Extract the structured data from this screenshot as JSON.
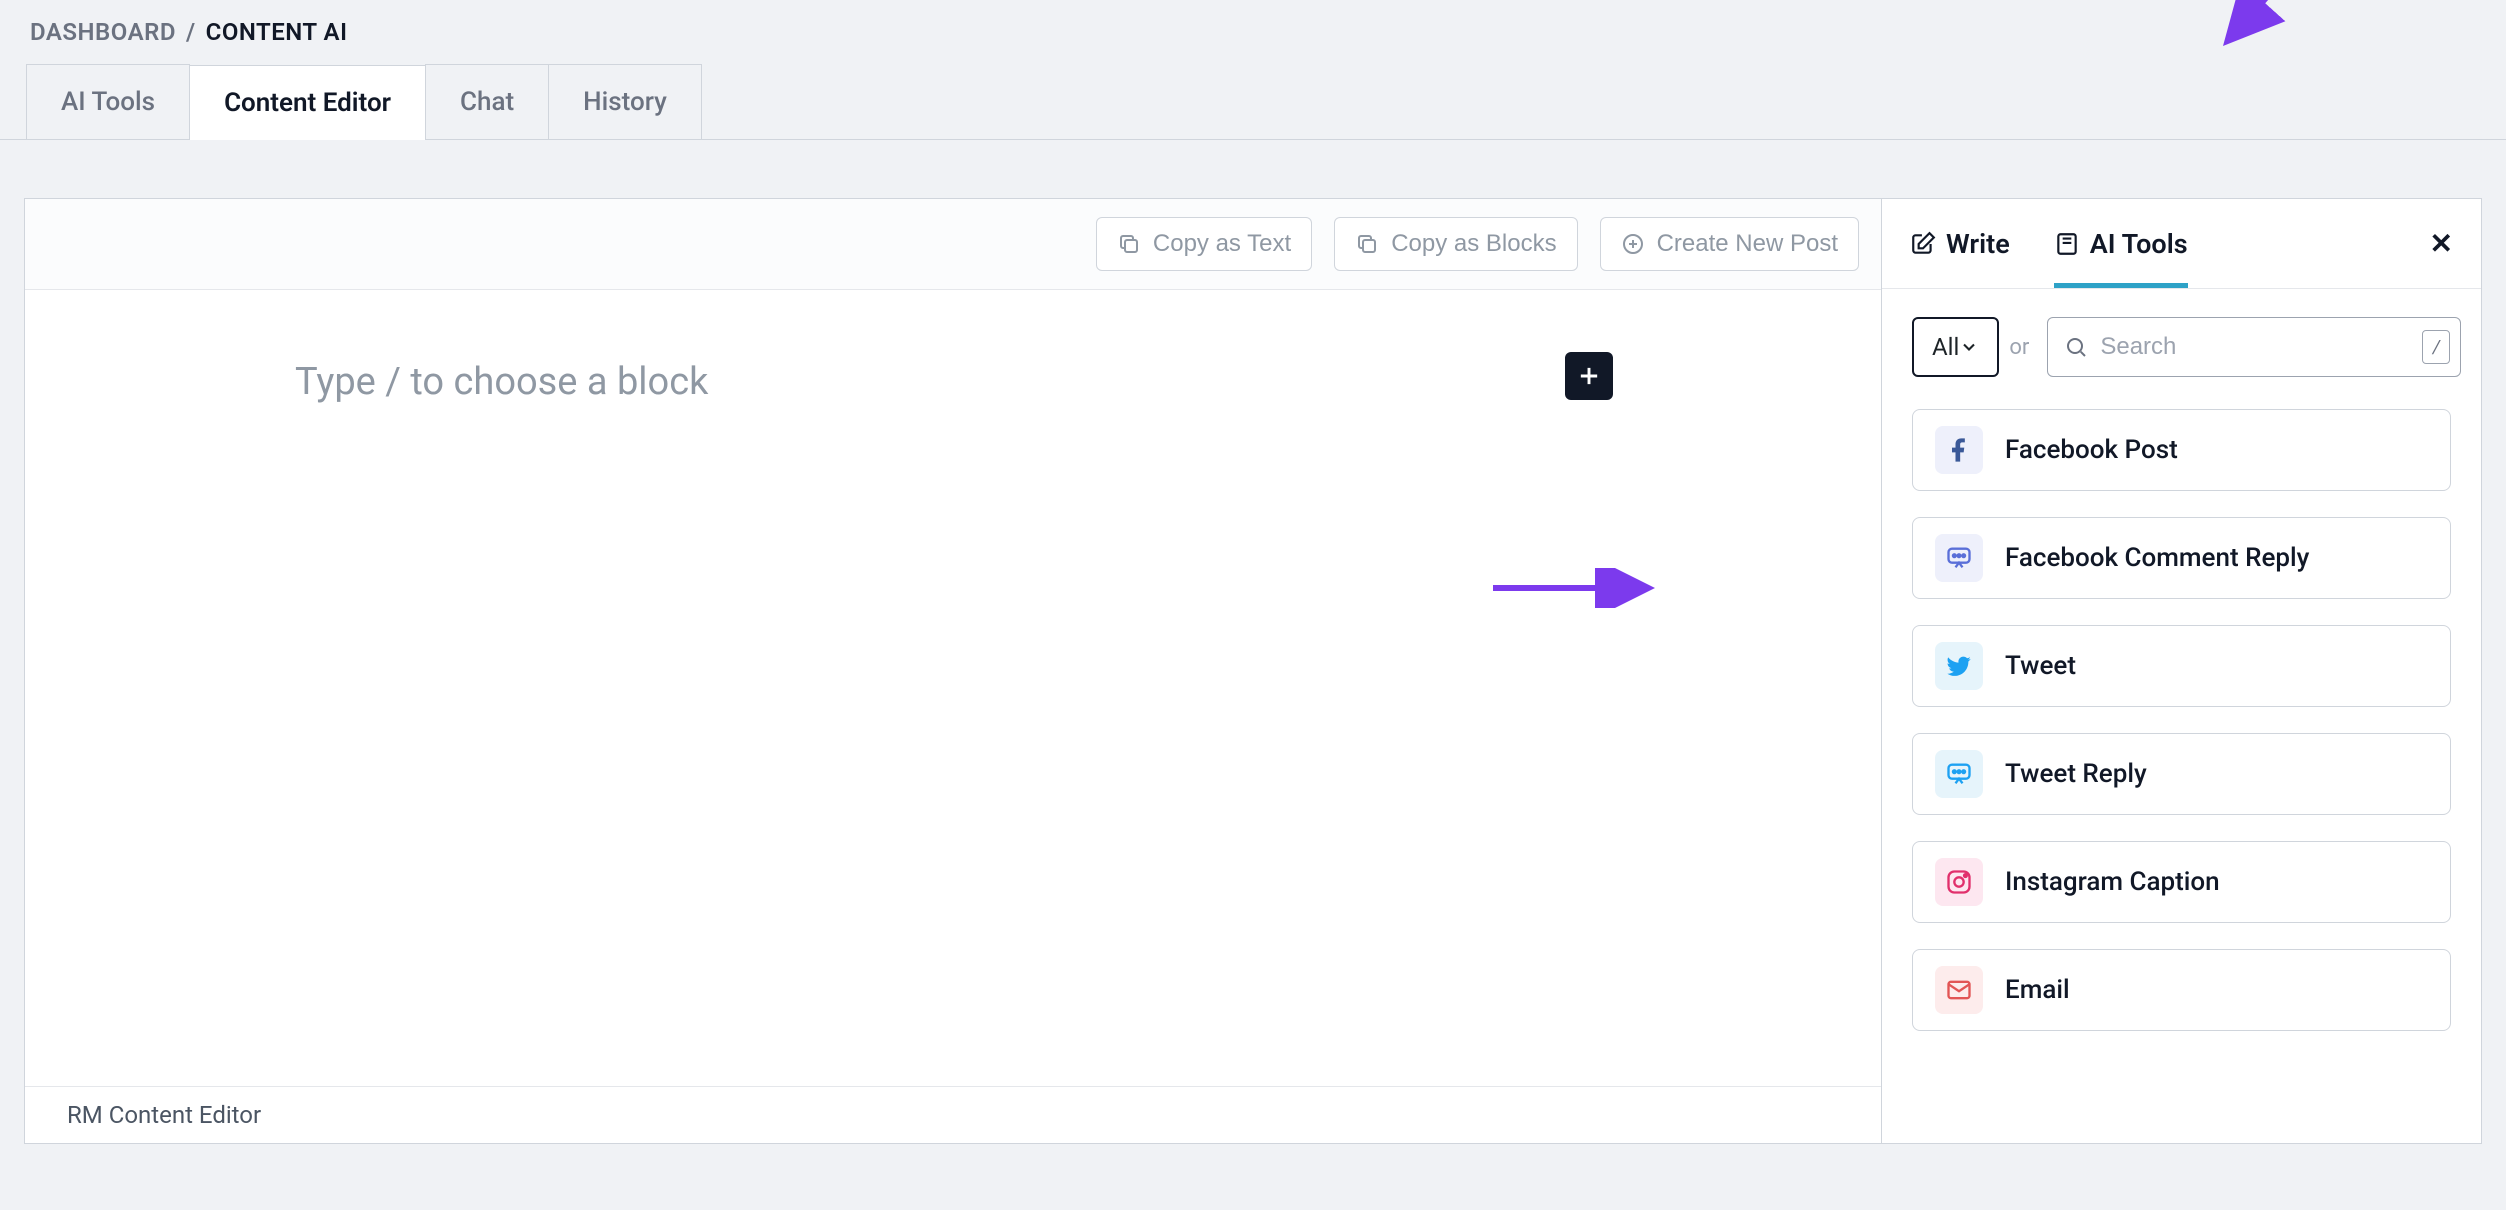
{
  "breadcrumb": {
    "root": "DASHBOARD",
    "separator": "/",
    "current": "CONTENT AI"
  },
  "tabs": [
    {
      "label": "AI Tools"
    },
    {
      "label": "Content Editor"
    },
    {
      "label": "Chat"
    },
    {
      "label": "History"
    }
  ],
  "active_tab_index": 1,
  "toolbar": {
    "copy_text": "Copy as Text",
    "copy_blocks": "Copy as Blocks",
    "create_post": "Create New Post"
  },
  "editor": {
    "placeholder": "Type / to choose a block"
  },
  "footer": {
    "label": "RM Content Editor"
  },
  "sidebar": {
    "tabs": {
      "write": "Write",
      "ai_tools": "AI Tools"
    },
    "active_tab": "ai_tools",
    "filter": {
      "selected": "All",
      "or_label": "or"
    },
    "search": {
      "placeholder": "Search",
      "kbd": "/"
    },
    "tools": [
      {
        "key": "facebook_post",
        "label": "Facebook Post",
        "icon": "facebook-icon",
        "icon_class": "ico-fb"
      },
      {
        "key": "facebook_comment_reply",
        "label": "Facebook Comment Reply",
        "icon": "comment-reply-icon",
        "icon_class": "ico-fbc"
      },
      {
        "key": "tweet",
        "label": "Tweet",
        "icon": "twitter-icon",
        "icon_class": "ico-tw"
      },
      {
        "key": "tweet_reply",
        "label": "Tweet Reply",
        "icon": "tweet-reply-icon",
        "icon_class": "ico-twr"
      },
      {
        "key": "instagram_caption",
        "label": "Instagram Caption",
        "icon": "instagram-icon",
        "icon_class": "ico-ig"
      },
      {
        "key": "email",
        "label": "Email",
        "icon": "email-icon",
        "icon_class": "ico-em"
      }
    ]
  },
  "icons": {
    "close": "✕"
  }
}
